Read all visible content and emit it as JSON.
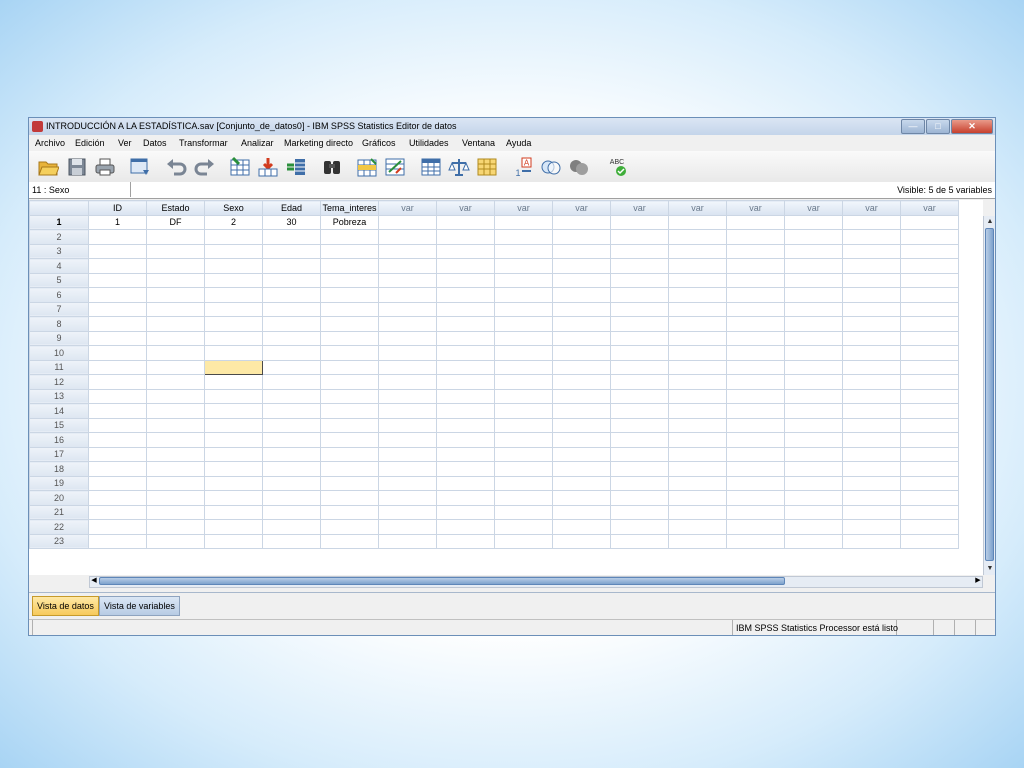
{
  "window": {
    "title": "INTRODUCCIÓN A LA ESTADÍSTICA.sav [Conjunto_de_datos0] - IBM SPSS Statistics Editor de datos",
    "min_glyph": "—",
    "max_glyph": "□",
    "close_glyph": "✕"
  },
  "menu": [
    "Archivo",
    "Edición",
    "Ver",
    "Datos",
    "Transformar",
    "Analizar",
    "Marketing directo",
    "Gráficos",
    "Utilidades",
    "Ventana",
    "Ayuda"
  ],
  "toolbar_icons": [
    "open-folder-icon",
    "save-icon",
    "print-icon",
    "dialog-recall-icon",
    "undo-icon",
    "redo-icon",
    "goto-case-icon",
    "goto-variable-icon",
    "variables-icon",
    "find-icon",
    "insert-cases-icon",
    "insert-variable-icon",
    "split-file-icon",
    "weight-cases-icon",
    "select-cases-icon",
    "value-labels-icon",
    "use-sets-icon",
    "show-all-variables-icon",
    "spell-check-icon"
  ],
  "cell_ref": "11 : Sexo",
  "visible_text": "Visible: 5 de 5 variables",
  "columns": [
    "ID",
    "Estado",
    "Sexo",
    "Edad",
    "Tema_interes",
    "var",
    "var",
    "var",
    "var",
    "var",
    "var",
    "var",
    "var",
    "var",
    "var"
  ],
  "rows": [
    [
      "1",
      "DF",
      "2",
      "30",
      "Pobreza"
    ]
  ],
  "row_count": 23,
  "selected_cell": {
    "row": 11,
    "column": "Sexo"
  },
  "tabs": {
    "data_view": "Vista de datos",
    "variable_view": "Vista de variables"
  },
  "status": "IBM SPSS Statistics Processor está listo",
  "colors": {
    "selected_cell": "#fde9a6",
    "active_tab": "#f7c95b",
    "titlebar": "#c4d5ea"
  }
}
